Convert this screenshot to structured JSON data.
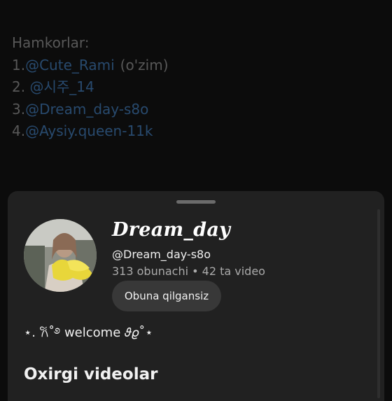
{
  "description": {
    "heading": "Hamkorlar:",
    "partners": [
      {
        "prefix": "1.",
        "mention": "@Cute_Rami",
        "suffix": "(o'zim)"
      },
      {
        "prefix": "2. ",
        "mention": "@시주_14",
        "suffix": ""
      },
      {
        "prefix": "3.",
        "mention": "@Dream_day-s8o",
        "suffix": ""
      },
      {
        "prefix": "4.",
        "mention": "@Aysiy.queen-11k",
        "suffix": ""
      }
    ]
  },
  "channel": {
    "name": "Dream_day",
    "handle": "@Dream_day-s8o",
    "stats": "313 obunachi • 42 ta video",
    "subscribe_label": "Obuna qilgansiz",
    "tagline": "⋆. 𐙚˚࿔ welcome 𝜗𝜚˚⋆"
  },
  "section": {
    "title": "Oxirgi videolar"
  },
  "colors": {
    "background": "#0c0c0c",
    "sheet": "#212121",
    "mention_link": "#284a6e",
    "button": "#383838"
  }
}
